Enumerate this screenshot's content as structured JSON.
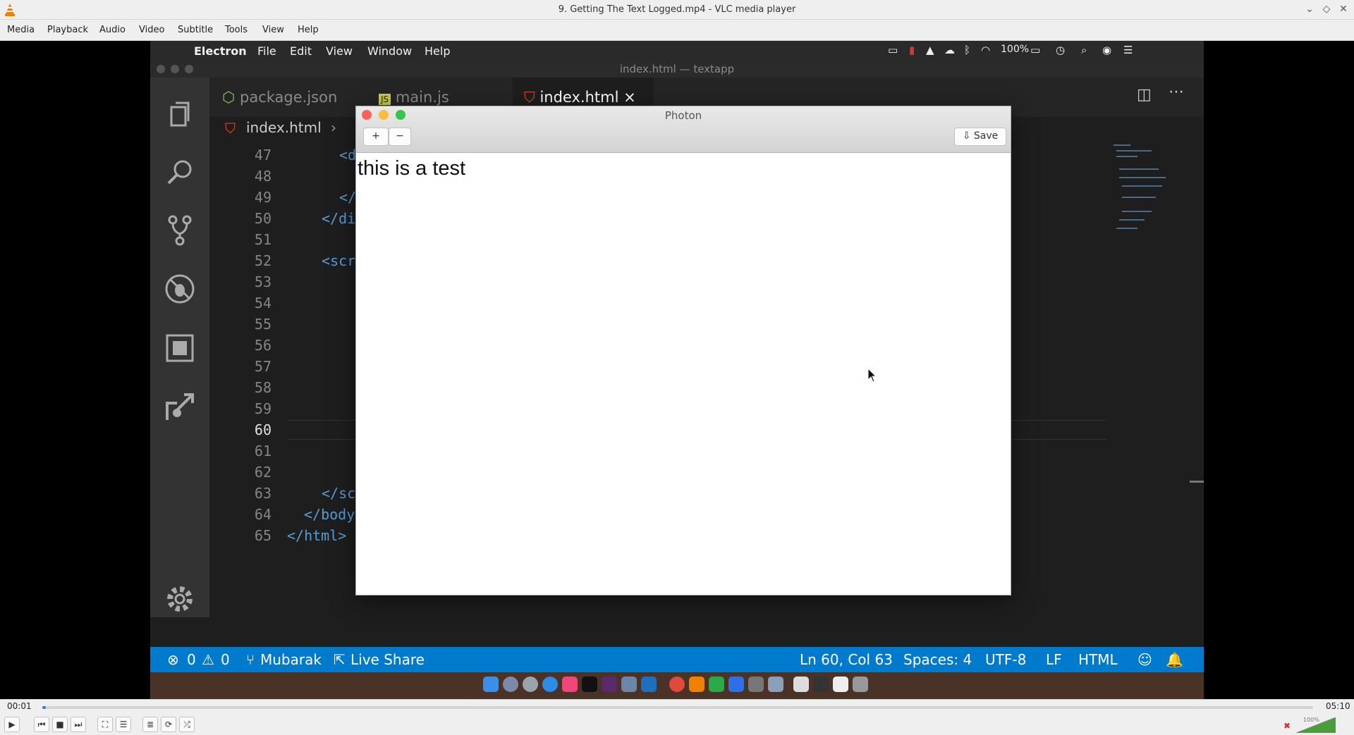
{
  "window": {
    "title": "9. Getting The Text Logged.mp4 - VLC media player"
  },
  "menu": [
    "Media",
    "Playback",
    "Audio",
    "Video",
    "Subtitle",
    "Tools",
    "View",
    "Help"
  ],
  "mac_menu": {
    "app": "Electron",
    "items": [
      "File",
      "Edit",
      "View",
      "Window",
      "Help"
    ],
    "battery": "100%"
  },
  "vscode": {
    "title": "index.html — textapp",
    "tabs": [
      {
        "label": "package.json"
      },
      {
        "label": "main.js"
      },
      {
        "label": "index.html",
        "close": "×"
      }
    ],
    "breadcrumb": "index.html",
    "line_numbers": [
      "47",
      "48",
      "49",
      "50",
      "51",
      "52",
      "53",
      "54",
      "55",
      "56",
      "57",
      "58",
      "59",
      "60",
      "61",
      "62",
      "63",
      "64",
      "65"
    ],
    "current_line": "60",
    "code": {
      "l47": "<d",
      "l49": "</",
      "l50": "</di",
      "l52": "<scr",
      "l63": "</sc",
      "l64": "</body",
      "l65": "</html>"
    }
  },
  "statusbar": {
    "errors": "0",
    "warnings": "0",
    "branch": "Mubarak",
    "liveshare": "Live Share",
    "position": "Ln 60, Col 63",
    "spaces": "Spaces: 4",
    "encoding": "UTF-8",
    "eol": "LF",
    "language": "HTML"
  },
  "photon": {
    "title": "Photon",
    "add": "+",
    "remove": "−",
    "save": "Save",
    "content": "this is a test"
  },
  "player": {
    "elapsed": "00:01",
    "total": "05:10",
    "progress": 0.003,
    "volume": "100%"
  },
  "colors": {
    "vscode_blue": "#007acc",
    "vlc_orange": "#f08000",
    "seek": "#2f7de1"
  }
}
